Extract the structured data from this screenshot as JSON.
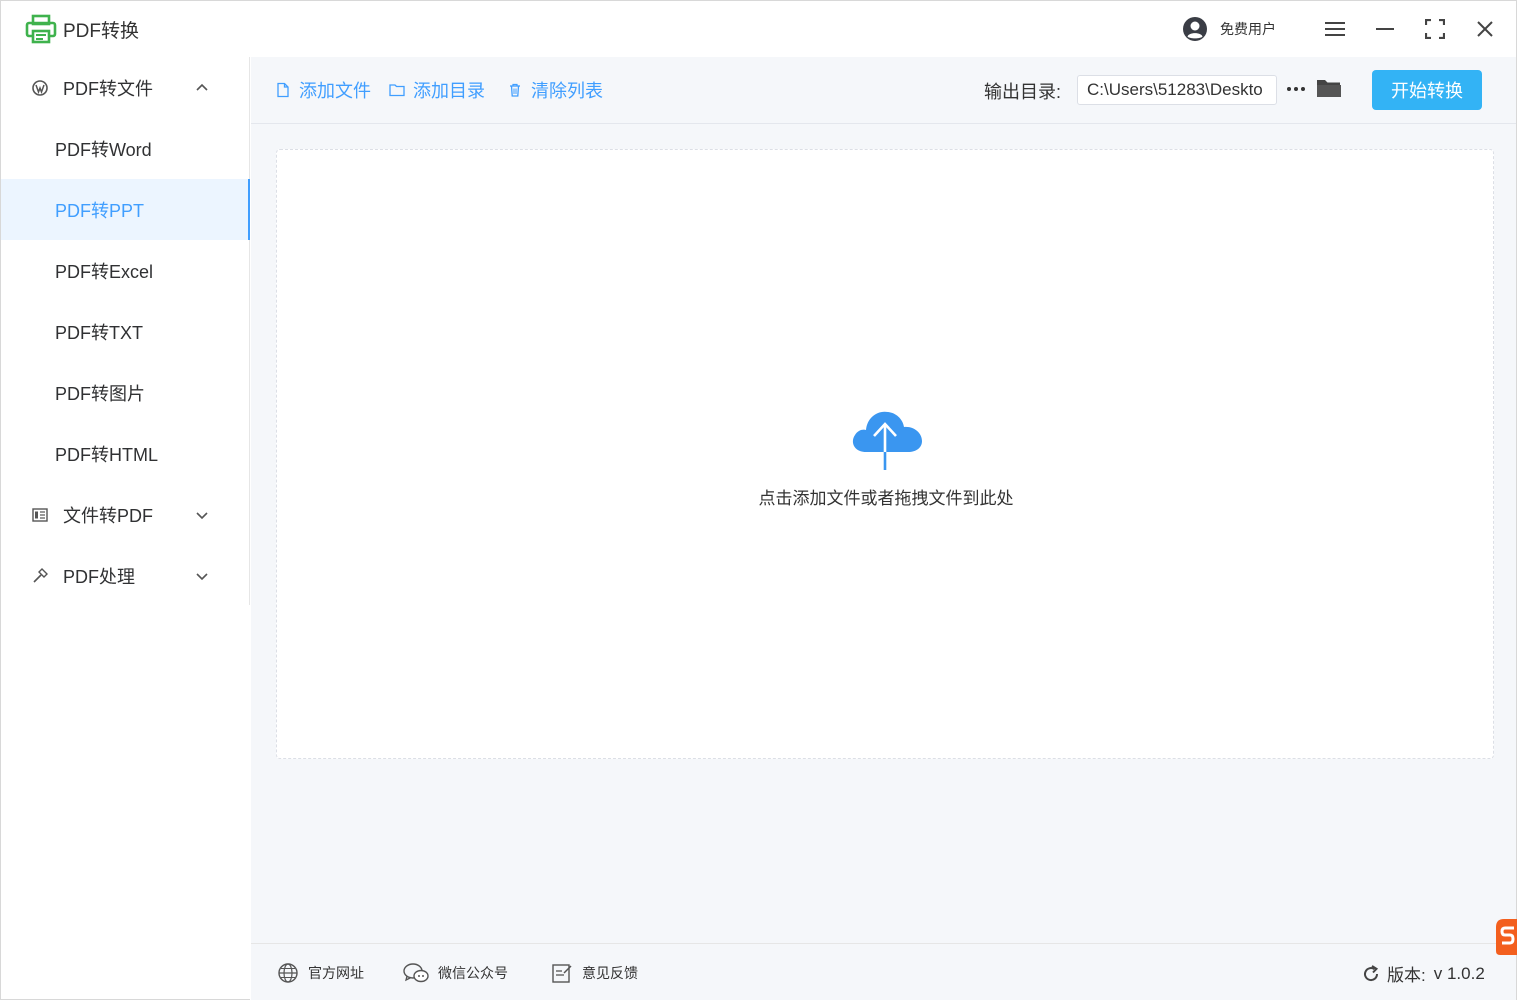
{
  "app": {
    "title": "PDF转换"
  },
  "user": {
    "name": "免费用户"
  },
  "sidebar": {
    "groups": [
      {
        "label": "PDF转文件",
        "expanded": true,
        "items": [
          "PDF转Word",
          "PDF转PPT",
          "PDF转Excel",
          "PDF转TXT",
          "PDF转图片",
          "PDF转HTML"
        ],
        "active_item": "PDF转PPT"
      },
      {
        "label": "文件转PDF",
        "expanded": false
      },
      {
        "label": "PDF处理",
        "expanded": false
      }
    ]
  },
  "toolbar": {
    "add_file": "添加文件",
    "add_dir": "添加目录",
    "clear_list": "清除列表",
    "output_label": "输出目录:",
    "output_path": "C:\\Users\\51283\\Deskto",
    "start_button": "开始转换"
  },
  "dropzone": {
    "hint": "点击添加文件或者拖拽文件到此处"
  },
  "footer": {
    "site": "官方网址",
    "wechat": "微信公众号",
    "feedback": "意见反馈",
    "version_label": "版本:",
    "version_value": "v 1.0.2"
  },
  "colors": {
    "accent": "#409eff",
    "start_button": "#33b3f5",
    "logo": "#3fb24d",
    "cloud": "#3a96f0"
  }
}
